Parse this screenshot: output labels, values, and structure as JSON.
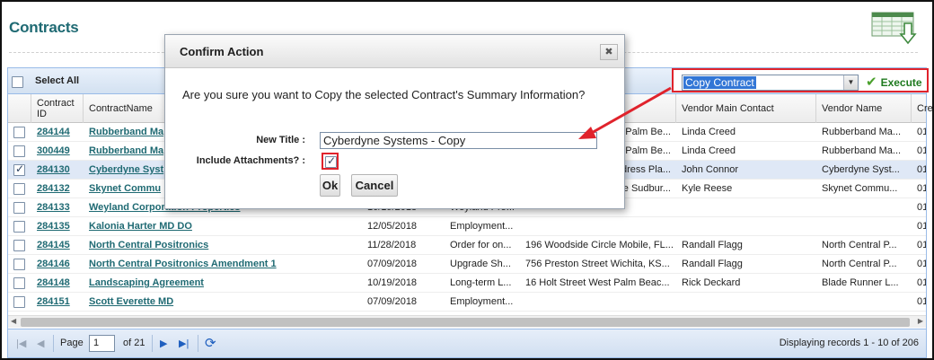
{
  "page": {
    "title": "Contracts"
  },
  "toolbar": {
    "select_all_label": "Select All",
    "action_value": "Copy Contract",
    "execute_label": "Execute"
  },
  "columns": [
    "Contract ID",
    "ContractName",
    "",
    "",
    "",
    "Vendor Main Contact",
    "Vendor Name",
    "Cre"
  ],
  "rows": [
    {
      "checked": false,
      "id": "284144",
      "name": "Rubberband Ma",
      "date": "",
      "desc": "",
      "addr": "Palm Be...",
      "contact": "Linda Creed",
      "vendor": "Rubberband Ma...",
      "cre": "01/"
    },
    {
      "checked": false,
      "id": "300449",
      "name": "Rubberband Ma",
      "date": "",
      "desc": "",
      "addr": "Palm Be...",
      "contact": "Linda Creed",
      "vendor": "Rubberband Ma...",
      "cre": "01/"
    },
    {
      "checked": true,
      "id": "284130",
      "name": "Cyberdyne Syst",
      "date": "",
      "desc": "",
      "addr": "dress Pla...",
      "contact": "John Connor",
      "vendor": "Cyberdyne Syst...",
      "cre": "01/"
    },
    {
      "checked": false,
      "id": "284132",
      "name": "Skynet Commu",
      "date": "",
      "desc": "",
      "addr": "e Sudbur...",
      "contact": "Kyle Reese",
      "vendor": "Skynet Commu...",
      "cre": "01/"
    },
    {
      "checked": false,
      "id": "284133",
      "name": "Weyland Corporation Properties",
      "date": "10/19/2018",
      "desc": "Weyland Pro...",
      "addr": "",
      "contact": "",
      "vendor": "",
      "cre": "01/"
    },
    {
      "checked": false,
      "id": "284135",
      "name": "Kalonia Harter MD DO",
      "date": "12/05/2018",
      "desc": "Employment...",
      "addr": "",
      "contact": "",
      "vendor": "",
      "cre": "01/"
    },
    {
      "checked": false,
      "id": "284145",
      "name": "North Central Positronics",
      "date": "11/28/2018",
      "desc": "Order for on...",
      "addr": "196 Woodside Circle Mobile, FL...",
      "contact": "Randall Flagg",
      "vendor": "North Central P...",
      "cre": "01/"
    },
    {
      "checked": false,
      "id": "284146",
      "name": "North Central Positronics Amendment 1",
      "date": "07/09/2018",
      "desc": "Upgrade Sh...",
      "addr": "756 Preston Street Wichita, KS...",
      "contact": "Randall Flagg",
      "vendor": "North Central P...",
      "cre": "01/"
    },
    {
      "checked": false,
      "id": "284148",
      "name": "Landscaping Agreement",
      "date": "10/19/2018",
      "desc": "Long-term L...",
      "addr": "16 Holt Street West Palm Beac...",
      "contact": "Rick Deckard",
      "vendor": "Blade Runner L...",
      "cre": "01/"
    },
    {
      "checked": false,
      "id": "284151",
      "name": "Scott Everette MD",
      "date": "07/09/2018",
      "desc": "Employment...",
      "addr": "",
      "contact": "",
      "vendor": "",
      "cre": "01/"
    }
  ],
  "pager": {
    "page_label": "Page",
    "page_value": "1",
    "of_label": "of 21",
    "display_text": "Displaying records 1 - 10 of 206"
  },
  "dialog": {
    "title": "Confirm Action",
    "close_glyph": "✖",
    "question": "Are you sure you want to Copy the selected Contract's Summary Information?",
    "new_title_label": "New Title :",
    "new_title_value": "Cyberdyne Systems - Copy",
    "attachments_label": "Include Attachments? :",
    "attachments_checked": true,
    "ok_label": "Ok",
    "cancel_label": "Cancel"
  },
  "colors": {
    "accent": "#1f6a73",
    "highlight": "#e0232c",
    "execute": "#1f7a1f"
  },
  "icons": [
    "excel-export-icon",
    "checkmark-icon",
    "close-icon",
    "first-page-icon",
    "prev-page-icon",
    "next-page-icon",
    "last-page-icon",
    "refresh-icon",
    "chevron-down-icon"
  ]
}
